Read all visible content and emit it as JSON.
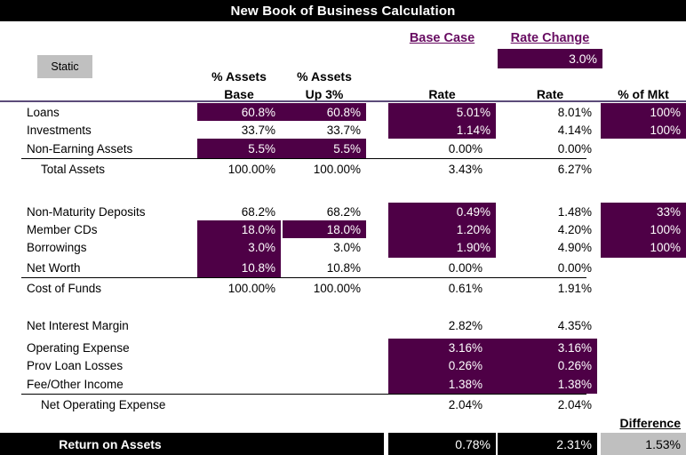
{
  "title": "New Book of Business Calculation",
  "static_button": {
    "label": "Static"
  },
  "headers": {
    "base_case": "Base Case",
    "rate_change": "Rate Change",
    "rate_change_value": "3.0%",
    "pct_assets_1_line1": "% Assets",
    "pct_assets_1_line2": "Base",
    "pct_assets_2_line1": "% Assets",
    "pct_assets_2_line2": "Up 3%",
    "rate_base": "Rate",
    "rate_up": "Rate",
    "pct_of_mkt": "% of Mkt",
    "difference": "Difference"
  },
  "assets": [
    {
      "label": "Loans",
      "pct_base": "60.8%",
      "pct_up": "60.8%",
      "rate_base": "5.01%",
      "rate_up": "8.01%",
      "pct_mkt": "100%"
    },
    {
      "label": "Investments",
      "pct_base": "33.7%",
      "pct_up": "33.7%",
      "rate_base": "1.14%",
      "rate_up": "4.14%",
      "pct_mkt": "100%"
    },
    {
      "label": "Non-Earning Assets",
      "pct_base": "5.5%",
      "pct_up": "5.5%",
      "rate_base": "0.00%",
      "rate_up": "0.00%",
      "pct_mkt": ""
    },
    {
      "label": "Total Assets",
      "pct_base": "100.00%",
      "pct_up": "100.00%",
      "rate_base": "3.43%",
      "rate_up": "6.27%",
      "pct_mkt": ""
    }
  ],
  "liabilities": [
    {
      "label": "Non-Maturity Deposits",
      "pct_base": "68.2%",
      "pct_up": "68.2%",
      "rate_base": "0.49%",
      "rate_up": "1.48%",
      "pct_mkt": "33%"
    },
    {
      "label": "Member CDs",
      "pct_base": "18.0%",
      "pct_up": "18.0%",
      "rate_base": "1.20%",
      "rate_up": "4.20%",
      "pct_mkt": "100%"
    },
    {
      "label": "Borrowings",
      "pct_base": "3.0%",
      "pct_up": "3.0%",
      "rate_base": "1.90%",
      "rate_up": "4.90%",
      "pct_mkt": "100%"
    },
    {
      "label": "Net Worth",
      "pct_base": "10.8%",
      "pct_up": "10.8%",
      "rate_base": "0.00%",
      "rate_up": "0.00%",
      "pct_mkt": ""
    },
    {
      "label": "Cost of Funds",
      "pct_base": "100.00%",
      "pct_up": "100.00%",
      "rate_base": "0.61%",
      "rate_up": "1.91%",
      "pct_mkt": ""
    }
  ],
  "margin": [
    {
      "label": "Net Interest Margin",
      "rate_base": "2.82%",
      "rate_up": "4.35%"
    },
    {
      "label": "Operating Expense",
      "rate_base": "3.16%",
      "rate_up": "3.16%"
    },
    {
      "label": "Prov Loan Losses",
      "rate_base": "0.26%",
      "rate_up": "0.26%"
    },
    {
      "label": "Fee/Other Income",
      "rate_base": "1.38%",
      "rate_up": "1.38%"
    },
    {
      "label": "Net Operating Expense",
      "rate_base": "2.04%",
      "rate_up": "2.04%"
    }
  ],
  "total_row": {
    "label": "Return on Assets",
    "rate_base": "0.78%",
    "rate_up": "2.31%",
    "difference": "1.53%"
  },
  "colors": {
    "highlight_purple": "#4e0046",
    "header_purple": "#670b61",
    "title_bar": "#000000",
    "static_gray": "#c0c0c0",
    "difference_gray": "#bfbfbf"
  }
}
